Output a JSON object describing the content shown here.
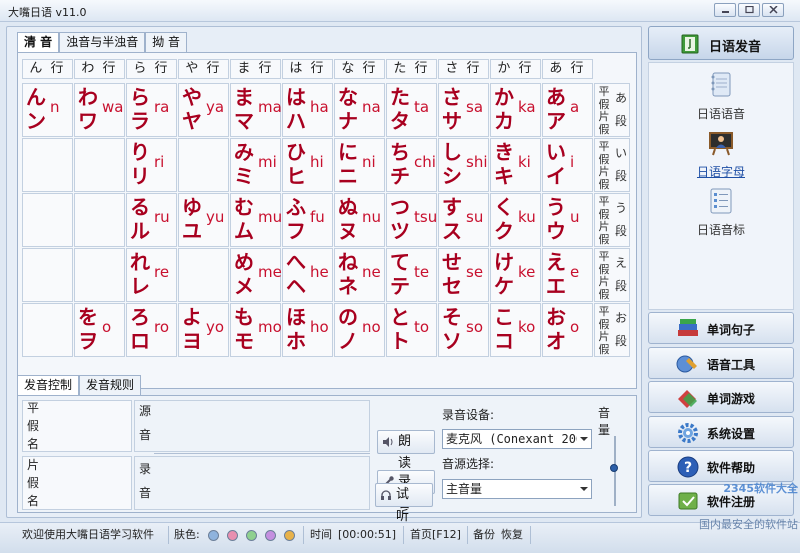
{
  "window": {
    "title": "大嘴日语 v11.0"
  },
  "main_tabs": [
    "清 音",
    "浊音与半浊音",
    "拗 音"
  ],
  "columns": [
    "ん 行",
    "わ 行",
    "ら 行",
    "や 行",
    "ま 行",
    "は 行",
    "な 行",
    "た 行",
    "さ 行",
    "か 行",
    "あ 行"
  ],
  "rows": [
    {
      "row_label": {
        "pk": [
          "平",
          "假",
          "片",
          "假"
        ],
        "dan": [
          "あ",
          "段"
        ]
      },
      "cells": [
        {
          "hira": "ん",
          "kata": "ン",
          "roma": "n"
        },
        {
          "hira": "わ",
          "kata": "ワ",
          "roma": "wa"
        },
        {
          "hira": "ら",
          "kata": "ラ",
          "roma": "ra"
        },
        {
          "hira": "や",
          "kata": "ヤ",
          "roma": "ya"
        },
        {
          "hira": "ま",
          "kata": "マ",
          "roma": "ma"
        },
        {
          "hira": "は",
          "kata": "ハ",
          "roma": "ha"
        },
        {
          "hira": "な",
          "kata": "ナ",
          "roma": "na"
        },
        {
          "hira": "た",
          "kata": "タ",
          "roma": "ta"
        },
        {
          "hira": "さ",
          "kata": "サ",
          "roma": "sa"
        },
        {
          "hira": "か",
          "kata": "カ",
          "roma": "ka"
        },
        {
          "hira": "あ",
          "kata": "ア",
          "roma": "a"
        }
      ]
    },
    {
      "row_label": {
        "pk": [
          "平",
          "假",
          "片",
          "假"
        ],
        "dan": [
          "い",
          "段"
        ]
      },
      "cells": [
        null,
        null,
        {
          "hira": "り",
          "kata": "リ",
          "roma": "ri"
        },
        null,
        {
          "hira": "み",
          "kata": "ミ",
          "roma": "mi"
        },
        {
          "hira": "ひ",
          "kata": "ヒ",
          "roma": "hi"
        },
        {
          "hira": "に",
          "kata": "ニ",
          "roma": "ni"
        },
        {
          "hira": "ち",
          "kata": "チ",
          "roma": "chi"
        },
        {
          "hira": "し",
          "kata": "シ",
          "roma": "shi"
        },
        {
          "hira": "き",
          "kata": "キ",
          "roma": "ki"
        },
        {
          "hira": "い",
          "kata": "イ",
          "roma": "i"
        }
      ]
    },
    {
      "row_label": {
        "pk": [
          "平",
          "假",
          "片",
          "假"
        ],
        "dan": [
          "う",
          "段"
        ]
      },
      "cells": [
        null,
        null,
        {
          "hira": "る",
          "kata": "ル",
          "roma": "ru"
        },
        {
          "hira": "ゆ",
          "kata": "ユ",
          "roma": "yu"
        },
        {
          "hira": "む",
          "kata": "ム",
          "roma": "mu"
        },
        {
          "hira": "ふ",
          "kata": "フ",
          "roma": "fu"
        },
        {
          "hira": "ぬ",
          "kata": "ヌ",
          "roma": "nu"
        },
        {
          "hira": "つ",
          "kata": "ツ",
          "roma": "tsu"
        },
        {
          "hira": "す",
          "kata": "ス",
          "roma": "su"
        },
        {
          "hira": "く",
          "kata": "ク",
          "roma": "ku"
        },
        {
          "hira": "う",
          "kata": "ウ",
          "roma": "u"
        }
      ]
    },
    {
      "row_label": {
        "pk": [
          "平",
          "假",
          "片",
          "假"
        ],
        "dan": [
          "え",
          "段"
        ]
      },
      "cells": [
        null,
        null,
        {
          "hira": "れ",
          "kata": "レ",
          "roma": "re"
        },
        null,
        {
          "hira": "め",
          "kata": "メ",
          "roma": "me"
        },
        {
          "hira": "へ",
          "kata": "ヘ",
          "roma": "he"
        },
        {
          "hira": "ね",
          "kata": "ネ",
          "roma": "ne"
        },
        {
          "hira": "て",
          "kata": "テ",
          "roma": "te"
        },
        {
          "hira": "せ",
          "kata": "セ",
          "roma": "se"
        },
        {
          "hira": "け",
          "kata": "ケ",
          "roma": "ke"
        },
        {
          "hira": "え",
          "kata": "エ",
          "roma": "e"
        }
      ]
    },
    {
      "row_label": {
        "pk": [
          "平",
          "假",
          "片",
          "假"
        ],
        "dan": [
          "お",
          "段"
        ]
      },
      "cells": [
        null,
        {
          "hira": "を",
          "kata": "ヲ",
          "roma": "o"
        },
        {
          "hira": "ろ",
          "kata": "ロ",
          "roma": "ro"
        },
        {
          "hira": "よ",
          "kata": "ヨ",
          "roma": "yo"
        },
        {
          "hira": "も",
          "kata": "モ",
          "roma": "mo"
        },
        {
          "hira": "ほ",
          "kata": "ホ",
          "roma": "ho"
        },
        {
          "hira": "の",
          "kata": "ノ",
          "roma": "no"
        },
        {
          "hira": "と",
          "kata": "ト",
          "roma": "to"
        },
        {
          "hira": "そ",
          "kata": "ソ",
          "roma": "so"
        },
        {
          "hira": "こ",
          "kata": "コ",
          "roma": "ko"
        },
        {
          "hira": "お",
          "kata": "オ",
          "roma": "o"
        }
      ]
    }
  ],
  "bottom_tabs": [
    "发音控制",
    "发音规则"
  ],
  "control": {
    "hiragana_label": [
      "平",
      "假",
      "名"
    ],
    "katakana_label": [
      "片",
      "假",
      "名"
    ],
    "source_label": [
      "源",
      "音"
    ],
    "record_label": [
      "录",
      "音"
    ],
    "btn_read": "朗 读",
    "btn_record": "录 音",
    "btn_listen": "试 听",
    "rec_device_label": "录音设备:",
    "rec_device_value": "麦克风 (Conexant 2067",
    "source_select_label": "音源选择:",
    "source_select_value": "主音量",
    "volume_label": "音量",
    "volume_level": 0.55
  },
  "status": {
    "welcome": "欢迎使用大嘴日语学习软件",
    "skin_label": "肤色:",
    "skins": [
      "#8fb3dd",
      "#e88fb0",
      "#8fd08f",
      "#c48fe0",
      "#e8b24a"
    ],
    "time_label": "时间",
    "time_value": "[00:00:51]",
    "home": "首页[F12]",
    "backup": "备份",
    "restore": "恢复"
  },
  "sidebar": {
    "header": "日语发音",
    "items": [
      {
        "label": "日语语音",
        "icon": "notebook-icon"
      },
      {
        "label": "日语字母",
        "icon": "teacher-board-icon",
        "selected": true
      },
      {
        "label": "日语音标",
        "icon": "list-document-icon"
      }
    ],
    "buttons": [
      {
        "label": "单词句子",
        "icon": "books-icon"
      },
      {
        "label": "语音工具",
        "icon": "toolbox-icon"
      },
      {
        "label": "单词游戏",
        "icon": "game-icon"
      },
      {
        "label": "系统设置",
        "icon": "gear-icon"
      },
      {
        "label": "软件帮助",
        "icon": "help-icon"
      },
      {
        "label": "软件注册",
        "icon": "register-icon"
      }
    ]
  },
  "watermark": {
    "line1": "2345软件大全",
    "line2": "国内最安全的软件站"
  }
}
